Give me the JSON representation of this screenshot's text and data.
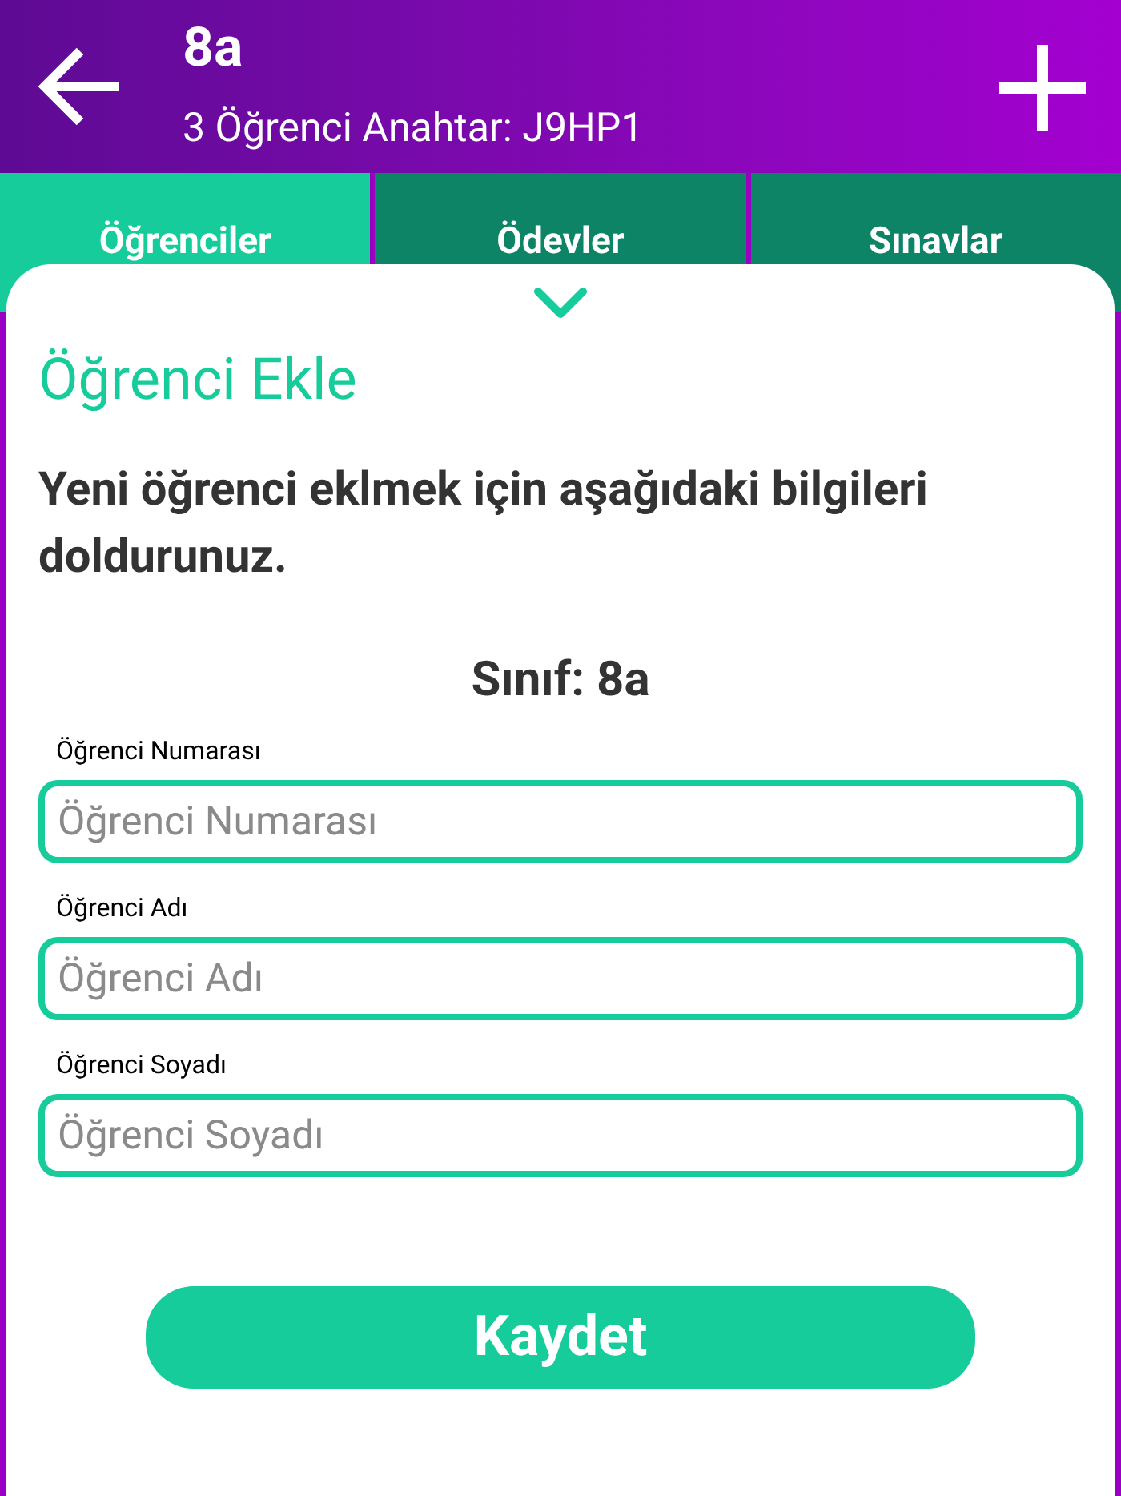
{
  "header": {
    "title": "8a",
    "subtitle": "3 Öğrenci Anahtar: J9HP1"
  },
  "tabs": [
    {
      "label": "Öğrenciler",
      "selected": true
    },
    {
      "label": "Ödevler",
      "selected": false
    },
    {
      "label": "Sınavlar",
      "selected": false
    }
  ],
  "sheet": {
    "title": "Öğrenci Ekle",
    "description": "Yeni öğrenci eklmek için aşağıdaki bilgileri doldurunuz.",
    "class_label": "Sınıf: 8a",
    "fields": [
      {
        "label": "Öğrenci Numarası",
        "placeholder": "Öğrenci Numarası"
      },
      {
        "label": "Öğrenci Adı",
        "placeholder": "Öğrenci Adı"
      },
      {
        "label": "Öğrenci Soyadı",
        "placeholder": "Öğrenci Soyadı"
      }
    ],
    "save_button": "Kaydet"
  }
}
